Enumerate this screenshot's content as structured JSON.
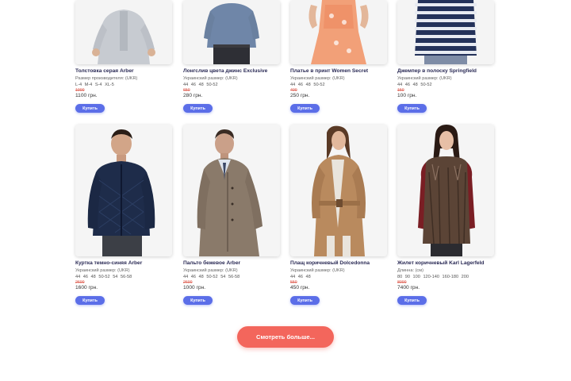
{
  "products": [
    {
      "title": "Толстовка серая Arber",
      "size_label": "Размер производителя: (UKR)",
      "sizes": "L-4 M-4 S-4 XL-5",
      "old_price": "1900",
      "price": "1100 грн.",
      "buy_label": "Купить"
    },
    {
      "title": "Лонгслив цвета джинс Exclusive",
      "size_label": "Украинский размер: (UKR)",
      "sizes": "44 46 48 50-52",
      "old_price": "650",
      "price": "280 грн.",
      "buy_label": "Купить"
    },
    {
      "title": "Платье в принт Women Secret",
      "size_label": "Украинский размер: (UKR)",
      "sizes": "44 46 48 50-52",
      "old_price": "400",
      "price": "250 грн.",
      "buy_label": "Купить"
    },
    {
      "title": "Джемпер в полоску Springfield",
      "size_label": "Украинский размер: (UKR)",
      "sizes": "44 46 48 50-52",
      "old_price": "150",
      "price": "100 грн.",
      "buy_label": "Купить"
    },
    {
      "title": "Куртка темно-синяя Arber",
      "size_label": "Украинский размер: (UKR)",
      "sizes": "44 46 48 50-52 54 56-58",
      "old_price": "2600",
      "price": "1600 грн.",
      "buy_label": "Купить"
    },
    {
      "title": "Пальто бежевое Arber",
      "size_label": "Украинский размер: (UKR)",
      "sizes": "44 46 48 50-52 54 56-58",
      "old_price": "2600",
      "price": "1000 грн.",
      "buy_label": "Купить"
    },
    {
      "title": "Плащ коричневый Dolcedonna",
      "size_label": "Украинский размер: (UKR)",
      "sizes": "44 46 48",
      "old_price": "550",
      "price": "450 грн.",
      "buy_label": "Купить"
    },
    {
      "title": "Жилет коричневый Karl Lagerfeld",
      "size_label": "Длинна: (см)",
      "sizes": "80 90 100 120-140 160-180 200",
      "old_price": "8000",
      "price": "7400 грн.",
      "buy_label": "Купить"
    }
  ],
  "more_button": "Смотреть больше...",
  "colors": {
    "buy_button": "#5b6ee8",
    "more_button": "#f3665c",
    "old_price": "#e0665a",
    "title": "#2a2a55"
  }
}
